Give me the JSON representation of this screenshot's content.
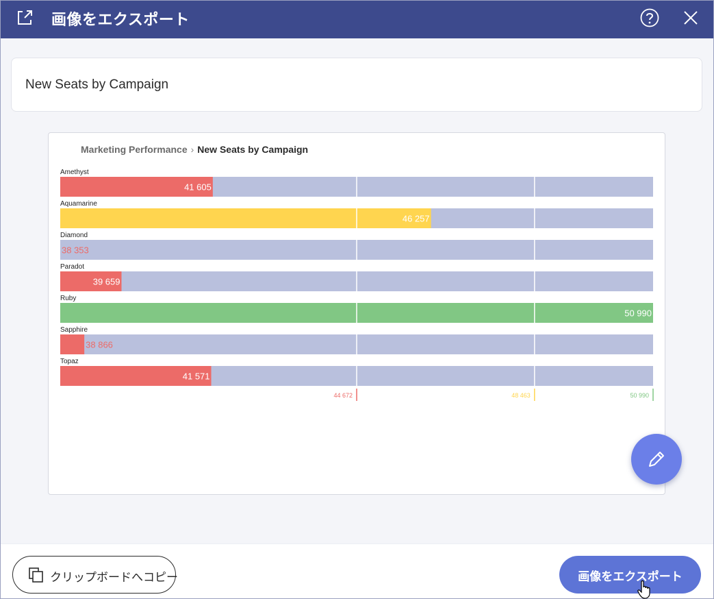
{
  "dialog": {
    "title": "画像をエクスポート",
    "icons": {
      "header": "export-icon",
      "help": "help-icon",
      "close": "close-icon"
    }
  },
  "name_field": {
    "value": "New Seats by Campaign",
    "placeholder": ""
  },
  "breadcrumb": {
    "parent": "Marketing Performance",
    "separator": "›",
    "current": "New Seats by Campaign"
  },
  "colors": {
    "header_bg": "#3d4a8d",
    "track": "#b9c0dd",
    "red": "#ec6b68",
    "yellow": "#ffd54f",
    "green": "#81c784",
    "primary_button": "#5d74d6",
    "fab": "#6b7fe8"
  },
  "chart_data": {
    "type": "bar",
    "orientation": "horizontal",
    "style": "bullet",
    "categories": [
      "Amethyst",
      "Aquamarine",
      "Diamond",
      "Paradot",
      "Ruby",
      "Sapphire",
      "Topaz"
    ],
    "values": [
      41605,
      46257,
      38353,
      39659,
      50990,
      38866,
      41571
    ],
    "value_labels": [
      "41 605",
      "46 257",
      "38 353",
      "39 659",
      "50 990",
      "38 866",
      "41 571"
    ],
    "bar_colors": [
      "red",
      "yellow",
      "red",
      "red",
      "green",
      "red",
      "red"
    ],
    "xlim": [
      38353,
      50990
    ],
    "thresholds": [
      {
        "value": 44672,
        "label": "44 672",
        "color": "red"
      },
      {
        "value": 48463,
        "label": "48 463",
        "color": "yellow"
      },
      {
        "value": 50990,
        "label": "50 990",
        "color": "green"
      }
    ],
    "grid": true,
    "legend": "none"
  },
  "fab": {
    "icon": "pencil-icon"
  },
  "footer": {
    "copy_label": "クリップボードへコピー",
    "copy_icon": "copy-icon",
    "export_label": "画像をエクスポート"
  }
}
